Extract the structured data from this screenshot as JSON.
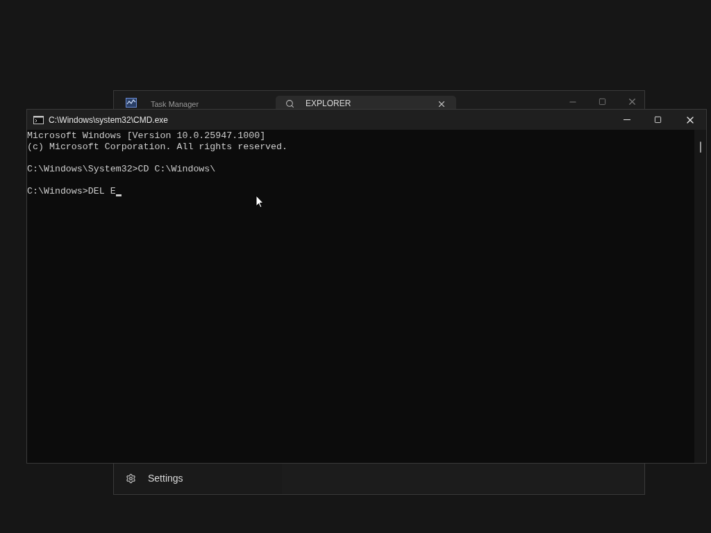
{
  "background_window": {
    "title": "Task Manager",
    "search": {
      "value": "EXPLORER"
    },
    "nav_items": [
      {
        "label": "Settings"
      }
    ]
  },
  "console_window": {
    "title": "C:\\Windows\\system32\\CMD.exe",
    "cursor_visible": true,
    "blocks": [
      [
        "Microsoft Windows [Version 10.0.25947.1000]",
        "(c) Microsoft Corporation. All rights reserved."
      ],
      [
        "C:\\Windows\\System32>CD C:\\Windows\\"
      ],
      [
        "C:\\Windows>DEL E"
      ]
    ]
  }
}
